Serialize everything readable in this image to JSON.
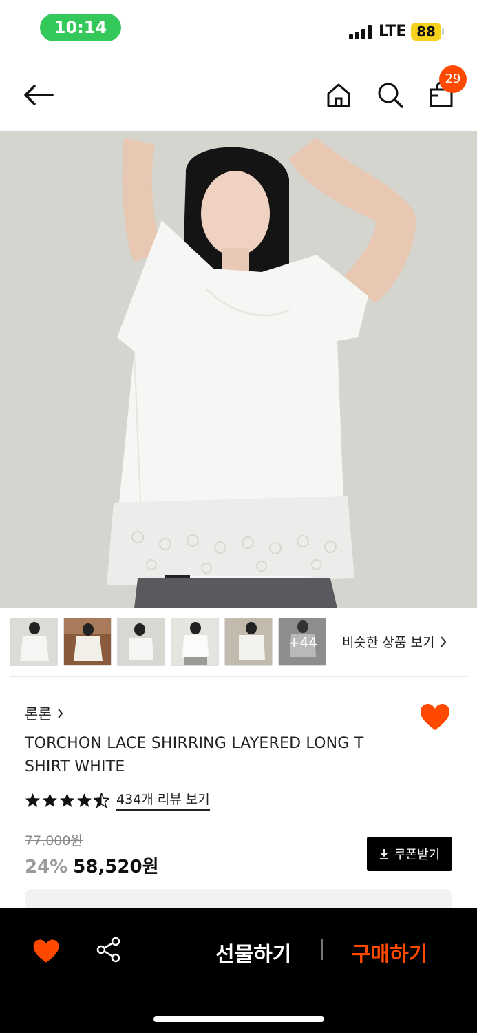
{
  "status_bar": {
    "time": "10:14",
    "network": "LTE",
    "battery": "88"
  },
  "nav": {
    "cart_count": "29",
    "icons": [
      "back-arrow-icon",
      "home-icon",
      "search-icon",
      "shopping-bag-icon"
    ]
  },
  "gallery": {
    "thumbnail_count": 5,
    "more_label": "+44",
    "similar_label": "비슷한 상품 보기"
  },
  "product": {
    "brand": "론론",
    "title": "TORCHON LACE SHIRRING LAYERED LONG T SHIRT WHITE",
    "rating": 4.5,
    "review_link": "434개 리뷰 보기",
    "original_price": "77,000원",
    "discount": "24%",
    "price": "58,520원",
    "coupon_label": "쿠폰받기",
    "favorited": true
  },
  "bottom_bar": {
    "gift_label": "선물하기",
    "buy_label": "구매하기"
  },
  "colors": {
    "accent": "#ff4800",
    "status_pill": "#34c759",
    "battery": "#f7d21c"
  }
}
